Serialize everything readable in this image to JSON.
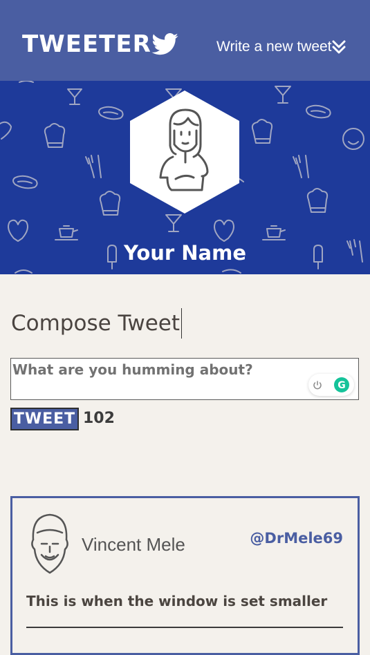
{
  "nav": {
    "logo_text": "TWEETER",
    "compose_link": "Write a new tweet",
    "background": "#4a5ea2"
  },
  "profile": {
    "name": "Your Name",
    "banner_color": "#1e3a9a",
    "avatar": "woman-avatar-icon"
  },
  "compose": {
    "title": "Compose Tweet",
    "placeholder": "What are you humming about?",
    "button_label": "TWEET",
    "char_count": "102"
  },
  "tweets": [
    {
      "author": "Vincent Mele",
      "handle": "@DrMele69",
      "text": "This is when the window is set smaller",
      "avatar": "man-avatar-icon"
    }
  ],
  "colors": {
    "accent": "#4a5ea2",
    "page_bg": "#f4f1ec",
    "grammarly": "#15c39a"
  }
}
